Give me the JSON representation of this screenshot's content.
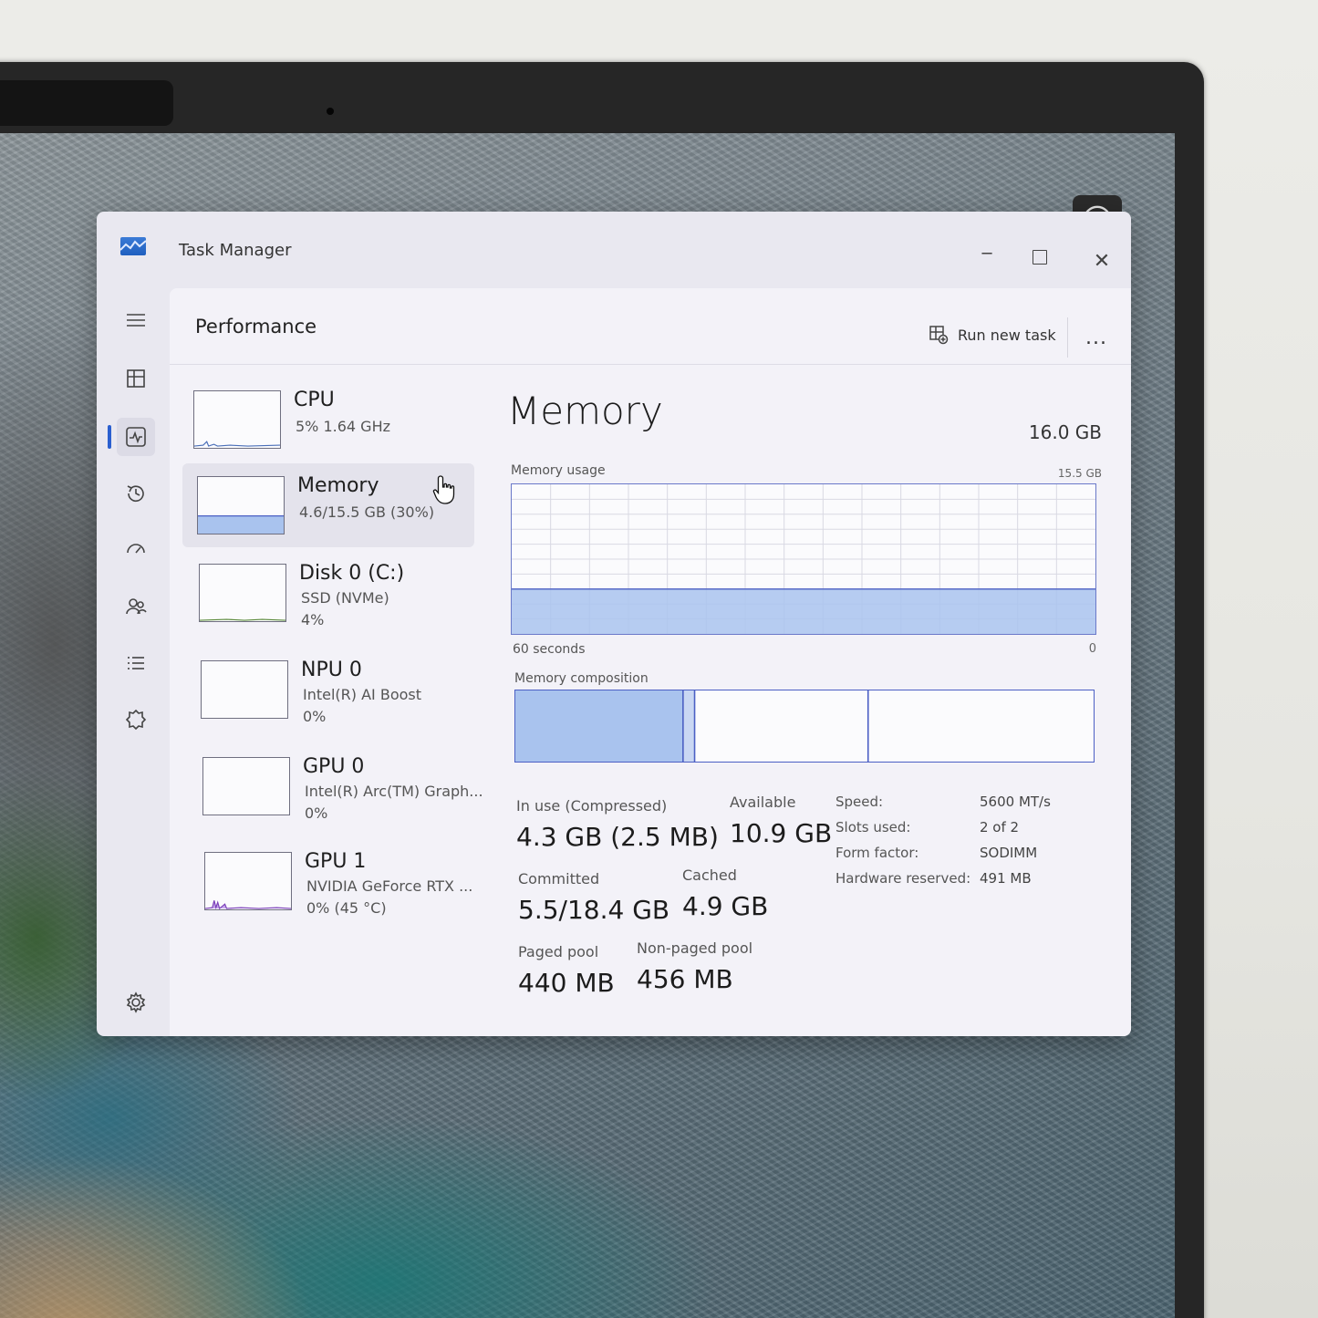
{
  "window": {
    "title": "Task Manager",
    "icons": {
      "app": "task-manager-icon",
      "minimize": "minimize-icon",
      "maximize": "maximize-icon",
      "close": "close-icon"
    }
  },
  "nav": {
    "items": [
      {
        "id": "menu",
        "icon": "hamburger-icon"
      },
      {
        "id": "processes",
        "icon": "processes-icon"
      },
      {
        "id": "performance",
        "icon": "performance-icon",
        "active": true
      },
      {
        "id": "app-history",
        "icon": "history-icon"
      },
      {
        "id": "startup",
        "icon": "startup-apps-icon"
      },
      {
        "id": "users",
        "icon": "users-icon"
      },
      {
        "id": "details",
        "icon": "details-list-icon"
      },
      {
        "id": "services",
        "icon": "services-icon"
      },
      {
        "id": "settings",
        "icon": "gear-icon"
      }
    ]
  },
  "header": {
    "title": "Performance",
    "run_new_task": "Run new task",
    "more": "..."
  },
  "devices": [
    {
      "name": "CPU",
      "line1": "5%  1.64 GHz",
      "line2": ""
    },
    {
      "name": "Memory",
      "line1": "4.6/15.5 GB (30%)",
      "line2": "",
      "selected": true
    },
    {
      "name": "Disk 0 (C:)",
      "line1": "SSD (NVMe)",
      "line2": "4%"
    },
    {
      "name": "NPU 0",
      "line1": "Intel(R) AI Boost",
      "line2": "0%"
    },
    {
      "name": "GPU 0",
      "line1": "Intel(R) Arc(TM) Graph...",
      "line2": "0%"
    },
    {
      "name": "GPU 1",
      "line1": "NVIDIA GeForce RTX ...",
      "line2": "0%  (45 °C)"
    }
  ],
  "memory": {
    "title": "Memory",
    "total": "16.0 GB",
    "usage_label": "Memory usage",
    "usage_max": "15.5 GB",
    "axis_left": "60 seconds",
    "axis_right": "0",
    "composition_label": "Memory composition",
    "usage_fraction": 0.3,
    "composition": {
      "in_use_fraction": 0.29,
      "modified_fraction": 0.02,
      "standby_fraction": 0.3
    },
    "stats": {
      "in_use": {
        "label": "In use (Compressed)",
        "value": "4.3 GB (2.5 MB)"
      },
      "available": {
        "label": "Available",
        "value": "10.9 GB"
      },
      "committed": {
        "label": "Committed",
        "value": "5.5/18.4 GB"
      },
      "cached": {
        "label": "Cached",
        "value": "4.9 GB"
      },
      "paged_pool": {
        "label": "Paged pool",
        "value": "440 MB"
      },
      "non_paged_pool": {
        "label": "Non-paged pool",
        "value": "456 MB"
      }
    },
    "props": [
      {
        "key": "Speed:",
        "value": "5600 MT/s"
      },
      {
        "key": "Slots used:",
        "value": "2 of 2"
      },
      {
        "key": "Form factor:",
        "value": "SODIMM"
      },
      {
        "key": "Hardware reserved:",
        "value": "491 MB"
      }
    ]
  },
  "colors": {
    "accent": "#2a5fcf",
    "memory_fill": "#a9c3ee",
    "memory_line": "#4b5fc4"
  }
}
